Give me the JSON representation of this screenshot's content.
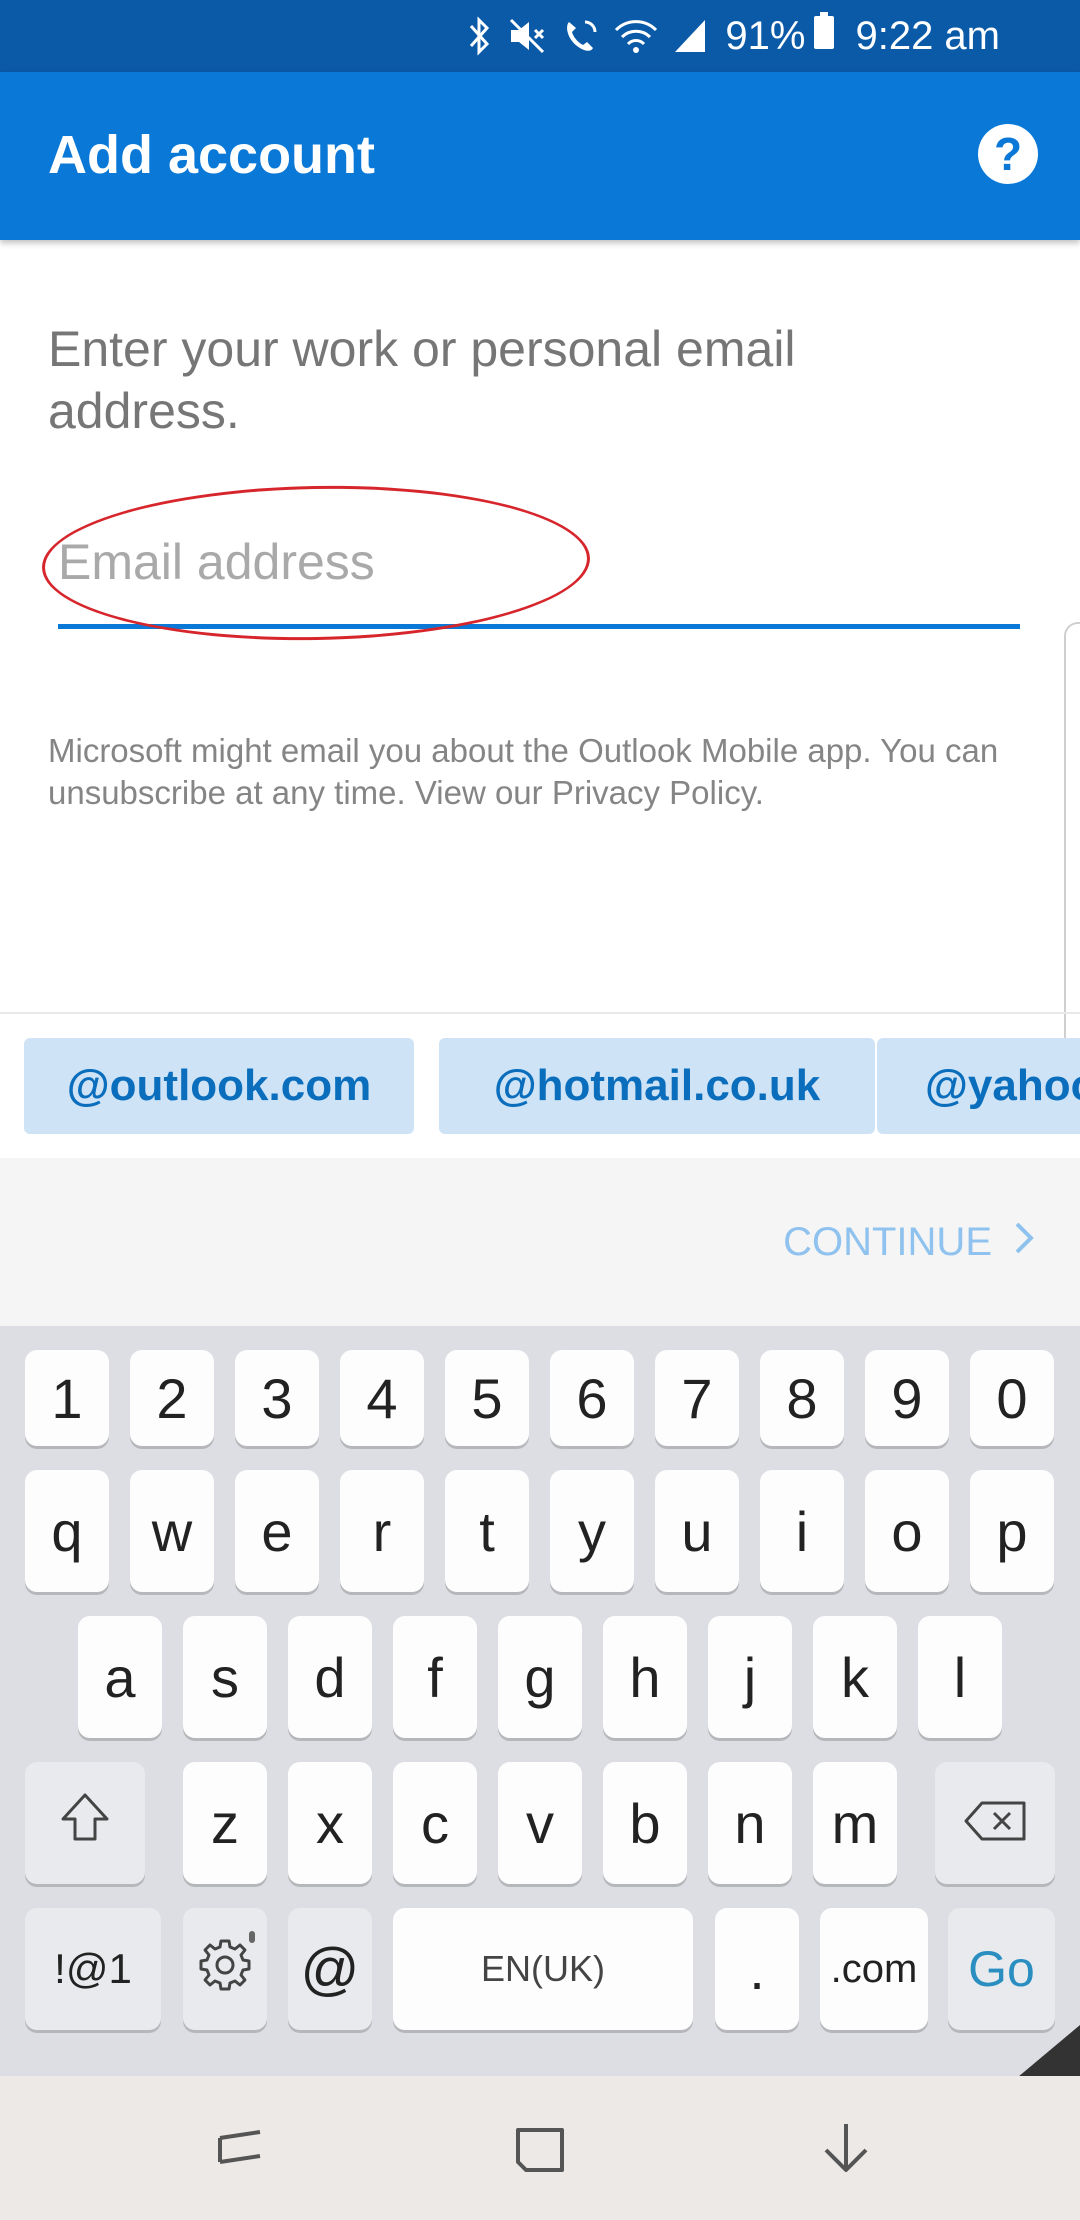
{
  "status_bar": {
    "battery": "91%",
    "time": "9:22 am"
  },
  "app_bar": {
    "title": "Add account",
    "help_label": "?"
  },
  "prompt": "Enter your work or personal email address.",
  "email": {
    "placeholder": "Email address",
    "value": ""
  },
  "disclaimer": "Microsoft might email you about the Outlook Mobile app. You can unsubscribe at any time. View our Privacy Policy.",
  "suggestions": [
    "@outlook.com",
    "@hotmail.co.uk",
    "@yahoo"
  ],
  "continue_label": "CONTINUE",
  "keyboard": {
    "number_row": [
      "1",
      "2",
      "3",
      "4",
      "5",
      "6",
      "7",
      "8",
      "9",
      "0"
    ],
    "row1": [
      "q",
      "w",
      "e",
      "r",
      "t",
      "y",
      "u",
      "i",
      "o",
      "p"
    ],
    "row2": [
      "a",
      "s",
      "d",
      "f",
      "g",
      "h",
      "j",
      "k",
      "l"
    ],
    "row3": [
      "z",
      "x",
      "c",
      "v",
      "b",
      "n",
      "m"
    ],
    "symbols_label": "!@1",
    "at_label": "@",
    "space_label": "EN(UK)",
    "period_label": ".",
    "dotcom_label": ".com",
    "go_label": "Go"
  },
  "colors": {
    "app_bar": "#0a78d7",
    "status_bar": "#0a5aa8",
    "accent": "#0a78d7",
    "chip_bg": "#cfe3f6",
    "annotation": "#d6262c",
    "go": "#2a8fc0"
  },
  "icons": {
    "status": [
      "bluetooth-icon",
      "mute-icon",
      "wifi-call-icon",
      "wifi-icon",
      "signal-icon",
      "battery-icon"
    ],
    "help": "help-icon",
    "continue": "chevron-right-icon",
    "shift": "shift-icon",
    "backspace": "backspace-icon",
    "settings": "gear-icon",
    "nav": [
      "recents-icon",
      "home-icon",
      "back-icon"
    ]
  }
}
